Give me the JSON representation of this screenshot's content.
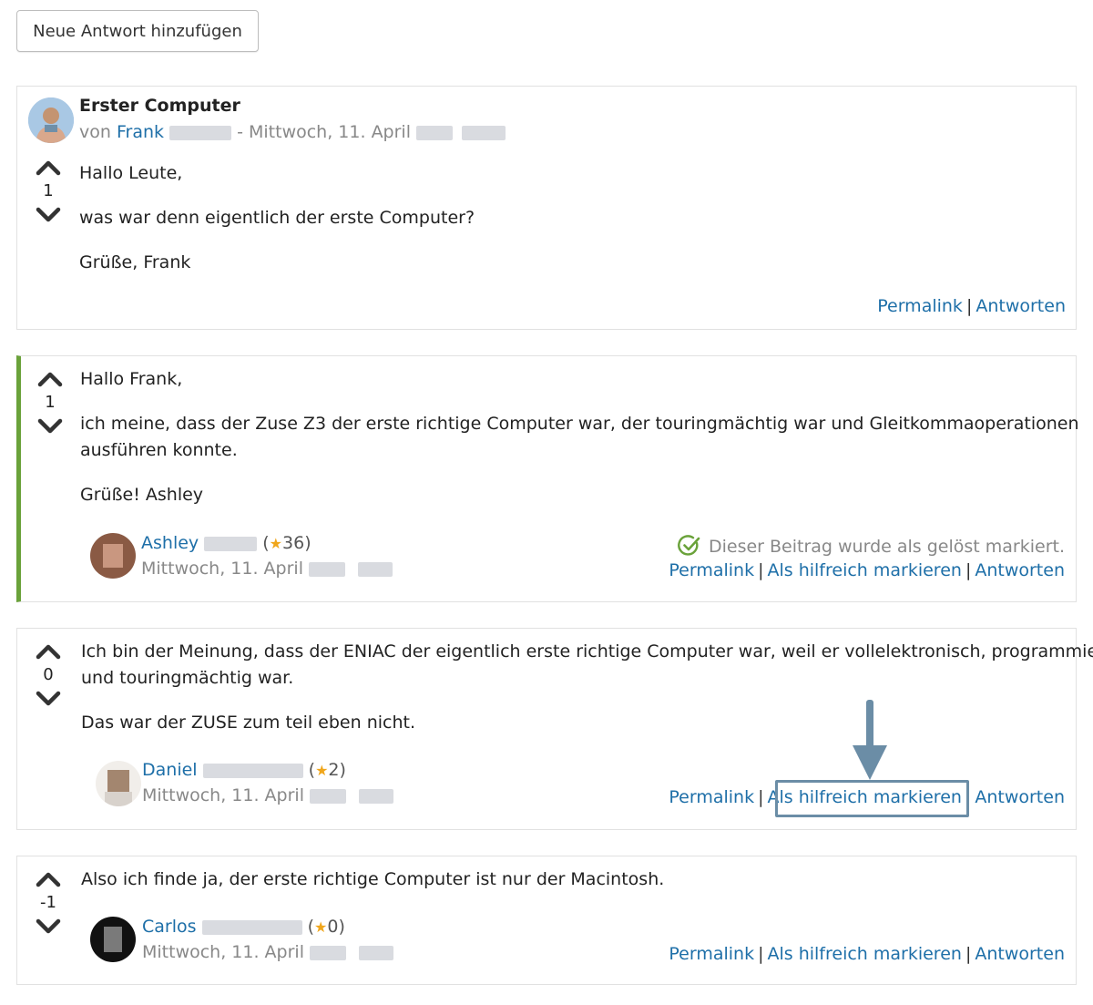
{
  "new_answer_button": "Neue Antwort hinzufügen",
  "colors": {
    "link": "#1e6fa8",
    "solved_bar": "#6aa23a",
    "star": "#f0a61b",
    "annotation": "#6b8da6"
  },
  "question": {
    "title": "Erster Computer",
    "by_prefix": "von",
    "author": "Frank",
    "date": "- Mittwoch, 11. April",
    "votes": "1",
    "paragraphs": [
      "Hallo Leute,",
      "was war denn eigentlich der erste Computer?",
      "Grüße, Frank"
    ],
    "links": {
      "permalink": "Permalink",
      "sep": "|",
      "reply": "Antworten"
    }
  },
  "answers": [
    {
      "votes": "1",
      "solved": true,
      "paragraphs": [
        "Hallo Frank,",
        "ich meine, dass der Zuse Z3 der erste richtige Computer war, der touringmächtig war und Gleitkommaoperationen",
        "ausführen konnte.",
        "Grüße! Ashley"
      ],
      "author": "Ashley",
      "points_open": "(",
      "points": "36",
      "points_close": ")",
      "date": "Mittwoch, 11. April",
      "solved_note": "Dieser Beitrag wurde als gelöst markiert.",
      "links": {
        "permalink": "Permalink",
        "helpful": "Als hilfreich markieren",
        "reply": "Antworten",
        "sep": "|"
      }
    },
    {
      "votes": "0",
      "solved": false,
      "paragraphs": [
        "Ich bin der Meinung, dass der ENIAC der eigentlich erste richtige Computer war, weil er vollelektronisch, programmierbar",
        "und touringmächtig war.",
        "Das war der ZUSE zum teil eben nicht."
      ],
      "author": "Daniel",
      "points_open": "(",
      "points": "2",
      "points_close": ")",
      "date": "Mittwoch, 11. April",
      "links": {
        "permalink": "Permalink",
        "helpful": "Als hilfreich markieren",
        "reply": "Antworten",
        "sep": "|"
      }
    },
    {
      "votes": "-1",
      "solved": false,
      "paragraphs": [
        "Also ich finde ja, der erste richtige Computer ist nur der Macintosh."
      ],
      "author": "Carlos",
      "points_open": "(",
      "points": "0",
      "points_close": ")",
      "date": "Mittwoch, 11. April",
      "links": {
        "permalink": "Permalink",
        "helpful": "Als hilfreich markieren",
        "reply": "Antworten",
        "sep": "|"
      }
    }
  ]
}
